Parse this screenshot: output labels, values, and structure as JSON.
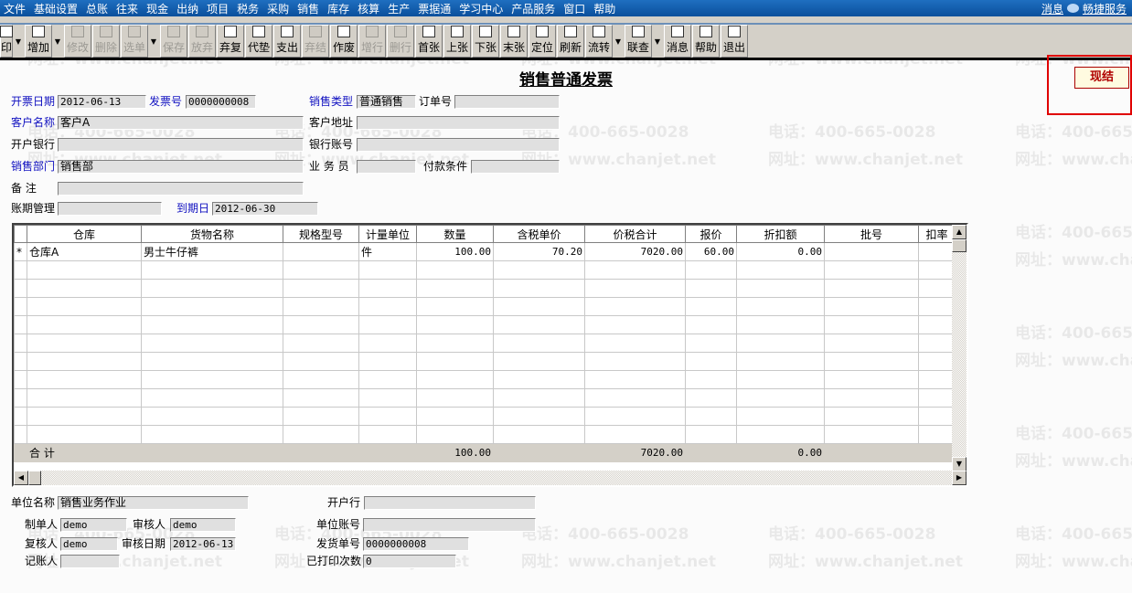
{
  "menu": [
    "文件",
    "基础设置",
    "总账",
    "往来",
    "现金",
    "出纳",
    "项目",
    "税务",
    "采购",
    "销售",
    "库存",
    "核算",
    "生产",
    "票据通",
    "学习中心",
    "产品服务",
    "窗口",
    "帮助"
  ],
  "menu_right": {
    "message": "消息",
    "service": "畅捷服务"
  },
  "toolbar": [
    {
      "label": "印",
      "icon": "print-icon",
      "enabled": true
    },
    {
      "dropdown": true
    },
    {
      "label": "增加",
      "icon": "add-icon",
      "enabled": true
    },
    {
      "dropdown": true
    },
    {
      "label": "修改",
      "icon": "edit-icon",
      "enabled": false
    },
    {
      "label": "删除",
      "icon": "delete-icon",
      "enabled": false
    },
    {
      "label": "选单",
      "icon": "select-icon",
      "enabled": false
    },
    {
      "dropdown": true
    },
    {
      "label": "保存",
      "icon": "save-icon",
      "enabled": false
    },
    {
      "label": "放弃",
      "icon": "undo-icon",
      "enabled": false
    },
    {
      "label": "弃复",
      "icon": "unreview-icon",
      "enabled": true
    },
    {
      "label": "代垫",
      "icon": "advance-icon",
      "enabled": true
    },
    {
      "label": "支出",
      "icon": "expense-icon",
      "enabled": true
    },
    {
      "label": "弃结",
      "icon": "unsettle-icon",
      "enabled": false
    },
    {
      "label": "作废",
      "icon": "void-icon",
      "enabled": true
    },
    {
      "label": "增行",
      "icon": "add-row-icon",
      "enabled": false
    },
    {
      "label": "删行",
      "icon": "delete-row-icon",
      "enabled": false
    },
    {
      "label": "首张",
      "icon": "first-icon",
      "enabled": true
    },
    {
      "label": "上张",
      "icon": "prev-icon",
      "enabled": true
    },
    {
      "label": "下张",
      "icon": "next-icon",
      "enabled": true
    },
    {
      "label": "末张",
      "icon": "last-icon",
      "enabled": true
    },
    {
      "label": "定位",
      "icon": "locate-icon",
      "enabled": true
    },
    {
      "label": "刷新",
      "icon": "refresh-icon",
      "enabled": true
    },
    {
      "label": "流转",
      "icon": "flow-icon",
      "enabled": true
    },
    {
      "dropdown": true
    },
    {
      "label": "联查",
      "icon": "link-query-icon",
      "enabled": true
    },
    {
      "dropdown": true
    },
    {
      "label": "消息",
      "icon": "message-icon",
      "enabled": true
    },
    {
      "label": "帮助",
      "icon": "help-icon",
      "enabled": true
    },
    {
      "label": "退出",
      "icon": "exit-icon",
      "enabled": true
    }
  ],
  "title": "销售普通发票",
  "settle_button": "现结",
  "watermark": {
    "phone": "电话：400-665-0028",
    "site": "网址：www.chanjet.net"
  },
  "header": {
    "invoice_date": {
      "label": "开票日期",
      "value": "2012-06-13"
    },
    "invoice_no": {
      "label": "发票号",
      "value": "0000000008"
    },
    "sales_type": {
      "label": "销售类型",
      "value": "普通销售"
    },
    "order_no": {
      "label": "订单号",
      "value": ""
    },
    "customer": {
      "label": "客户名称",
      "value": "客户A"
    },
    "customer_address": {
      "label": "客户地址",
      "value": ""
    },
    "bank": {
      "label": "开户银行",
      "value": ""
    },
    "bank_account": {
      "label": "银行账号",
      "value": ""
    },
    "department": {
      "label": "销售部门",
      "value": "销售部"
    },
    "salesman": {
      "label": "业 务 员",
      "value": ""
    },
    "payment_terms": {
      "label": "付款条件",
      "value": ""
    },
    "remark": {
      "label": "备    注",
      "value": ""
    },
    "credit_mgmt": {
      "label": "账期管理",
      "value": ""
    },
    "due_date": {
      "label": "到期日",
      "value": "2012-06-30"
    }
  },
  "grid": {
    "columns": [
      "",
      "仓库",
      "货物名称",
      "规格型号",
      "计量单位",
      "数量",
      "含税单价",
      "价税合计",
      "报价",
      "折扣额",
      "批号",
      "扣率"
    ],
    "rows": [
      [
        "*",
        "仓库A",
        "男士牛仔裤",
        "",
        "件",
        "100.00",
        "70.20",
        "7020.00",
        "60.00",
        "0.00",
        "",
        ""
      ]
    ],
    "total": [
      "",
      "合 计",
      "",
      "",
      "",
      "100.00",
      "",
      "7020.00",
      "",
      "0.00",
      "",
      ""
    ]
  },
  "footer": {
    "company": {
      "label": "单位名称",
      "value": "销售业务作业"
    },
    "open_bank": {
      "label": "开户行",
      "value": ""
    },
    "maker": {
      "label": "制单人",
      "value": "demo"
    },
    "reviewer": {
      "label": "审核人",
      "value": "demo"
    },
    "company_account": {
      "label": "单位账号",
      "value": ""
    },
    "checker": {
      "label": "复核人",
      "value": "demo"
    },
    "review_date": {
      "label": "审核日期",
      "value": "2012-06-13"
    },
    "delivery_no": {
      "label": "发货单号",
      "value": "0000000008"
    },
    "bookkeeper": {
      "label": "记账人",
      "value": ""
    },
    "print_count": {
      "label": "已打印次数",
      "value": "0"
    }
  }
}
